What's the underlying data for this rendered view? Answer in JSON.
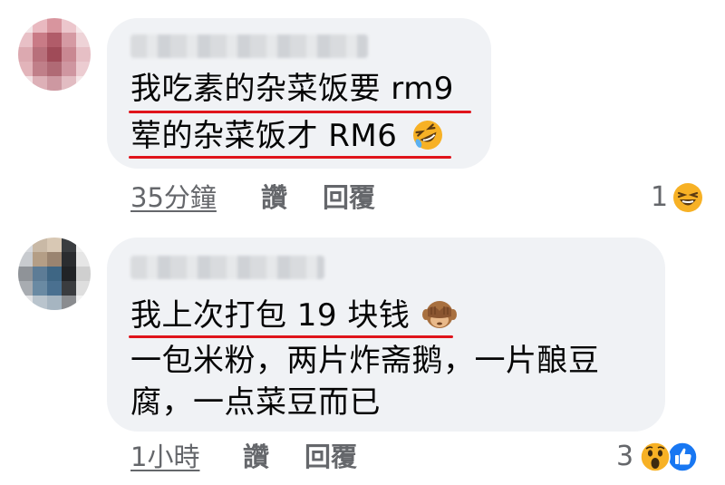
{
  "comments": [
    {
      "lines": [
        "我吃素的杂菜饭要 rm9",
        "荤的杂菜饭才 RM6"
      ],
      "time": "35分鐘",
      "like": "讚",
      "reply": "回覆",
      "reaction_count": "1",
      "reaction_icons": [
        "laughing-face-icon"
      ]
    },
    {
      "lines": [
        "我上次打包 19 块钱",
        "一包米粉，两片炸斋鹅，一片酿豆",
        "腐，一点菜豆而已"
      ],
      "time": "1小時",
      "like": "讚",
      "reply": "回覆",
      "reaction_count": "3",
      "reaction_icons": [
        "wow-face-icon",
        "like-thumb-icon"
      ]
    }
  ],
  "colors": {
    "bubble": "#f0f2f5",
    "underline": "#e0141b",
    "secondary_text": "#65676b",
    "like_blue": "#1877f2",
    "emoji_yellow": "#f7b125"
  }
}
